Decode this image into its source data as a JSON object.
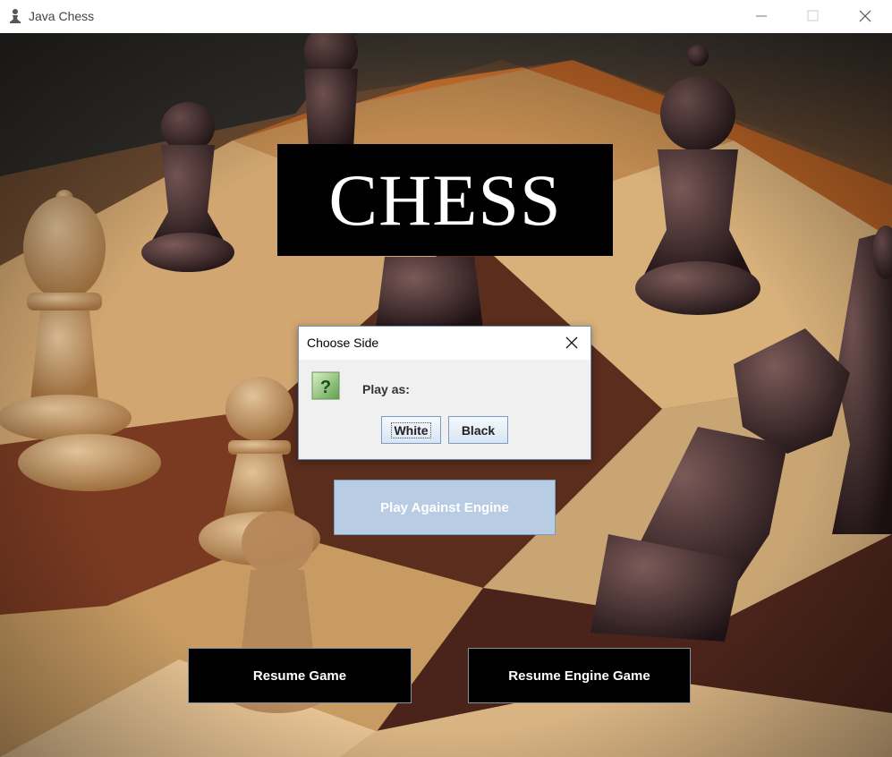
{
  "window": {
    "title": "Java Chess",
    "icon": "chess-pawn-icon",
    "controls": [
      "minimize-icon",
      "maximize-icon",
      "close-icon"
    ]
  },
  "menu": {
    "banner": "CHESS",
    "play_engine_label": "Play Against Engine",
    "resume_game_label": "Resume Game",
    "resume_engine_label": "Resume Engine Game"
  },
  "dialog": {
    "title": "Choose Side",
    "icon": "question-icon",
    "message": "Play as:",
    "buttons": [
      "White",
      "Black"
    ],
    "focused_button": "White"
  },
  "colors": {
    "banner_bg": "#000000",
    "engine_button_bg": "#b8cde4",
    "dialog_bg": "#f0f0f0",
    "dialog_button_border": "#7a9cc4",
    "question_icon": "#4caf50"
  }
}
